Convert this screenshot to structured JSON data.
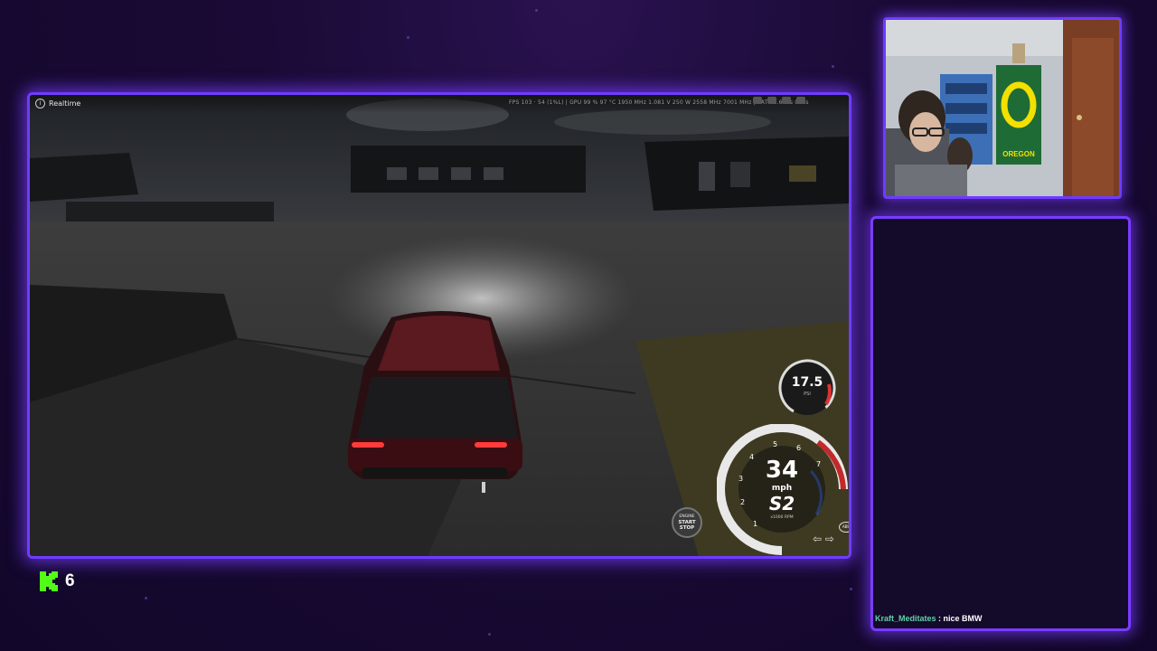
{
  "game": {
    "mode_label": "Realtime",
    "perf_overlay": "FPS 103 · 54 (1%L) | GPU 99 % 97 °C 1950 MHz 1.081 V 250 W 2558 MHz 7001 MHz | LAT 32.6 ms 0 ms",
    "boost_gauge": {
      "value": "17.5",
      "unit": "PSI"
    },
    "speedometer": {
      "speed": "34",
      "speed_unit": "mph",
      "gear": "S2",
      "rpm_label": "x1000 RPM",
      "rpm_ticks": [
        "1",
        "2",
        "3",
        "4",
        "5",
        "6",
        "7"
      ],
      "park_indicator": "P",
      "abs_indicator": "ABS"
    },
    "start_stop": {
      "line1": "ENGINE",
      "line2": "START",
      "line3": "STOP"
    }
  },
  "stream": {
    "platform_icon": "kick-icon",
    "viewer_count": "6"
  },
  "webcam": {
    "flag_text": "OREGON"
  },
  "chat": {
    "messages": [
      {
        "user": "Kraft_Meditates",
        "separator": " : ",
        "text": "nice BMW"
      }
    ]
  },
  "colors": {
    "accent": "#6f3cff",
    "kick_green": "#53fc18",
    "chat_user": "#5fd3a6"
  }
}
